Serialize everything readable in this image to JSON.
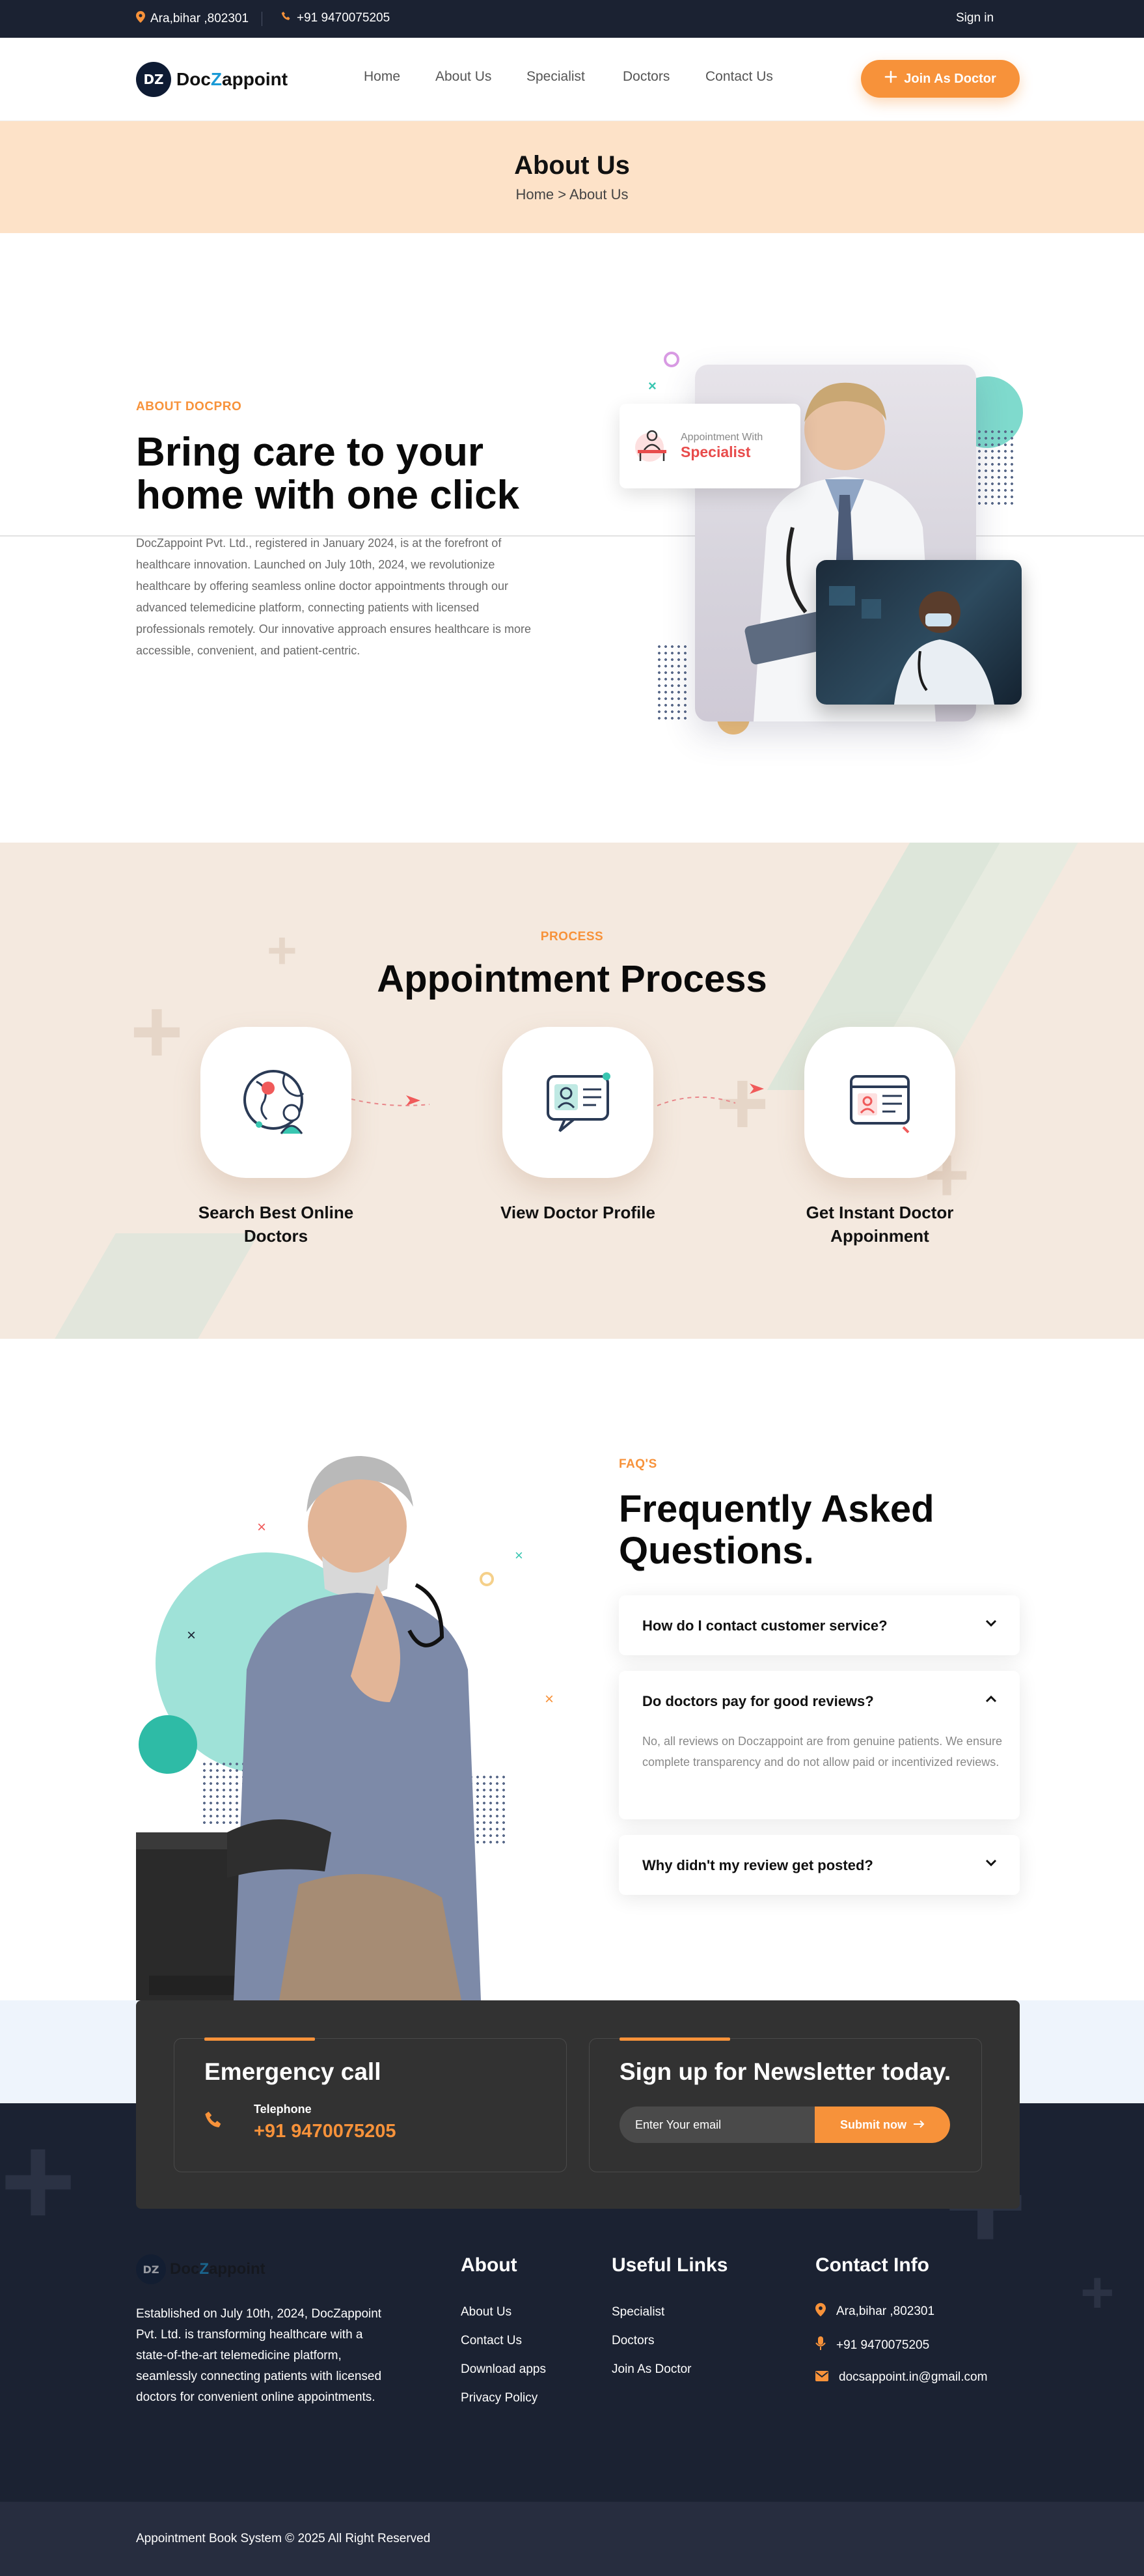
{
  "topbar": {
    "address": "Ara,bihar ,802301",
    "phone": "+91 9470075205",
    "signin": "Sign in"
  },
  "header": {
    "logo_mark": "DZ",
    "logo_prefix": "Doc",
    "logo_z": "Z",
    "logo_suffix": "appoint",
    "nav": [
      "Home",
      "About Us",
      "Specialist",
      "Doctors",
      "Contact Us"
    ],
    "cta": "Join As Doctor"
  },
  "banner": {
    "title": "About Us",
    "crumb_home": "Home",
    "crumb_sep": ">",
    "crumb_current": "About Us"
  },
  "about": {
    "eyebrow": "ABOUT DOCPRO",
    "heading_line1": "Bring care to your",
    "heading_line2": "home with one click",
    "paragraph": "DocZappoint Pvt. Ltd., registered in January 2024, is at the forefront of healthcare innovation. Launched on July 10th, 2024, we revolutionize healthcare by offering seamless online doctor appointments through our advanced telemedicine platform, connecting patients with licensed professionals remotely. Our innovative approach ensures healthcare is more accessible, convenient, and patient-centric.",
    "appointment_small": "Appointment With",
    "appointment_big": "Specialist"
  },
  "process": {
    "eyebrow": "PROCESS",
    "title": "Appointment Process",
    "steps": [
      {
        "label": "Search Best Online Doctors"
      },
      {
        "label": "View Doctor Profile"
      },
      {
        "label": "Get Instant Doctor Appoinment"
      }
    ]
  },
  "faq": {
    "eyebrow": "FAQ'S",
    "title_line1": "Frequently Asked",
    "title_line2": "Questions.",
    "items": [
      {
        "q": "How do I contact customer service?",
        "a": ""
      },
      {
        "q": "Do doctors pay for good reviews?",
        "a": "No, all reviews on Doczappoint are from genuine patients. We ensure complete transparency and do not allow paid or incentivized reviews."
      },
      {
        "q": "Why didn't my review get posted?",
        "a": ""
      }
    ]
  },
  "cta": {
    "emergency_title": "Emergency call",
    "telephone_label": "Telephone",
    "telephone_value": "+91 9470075205",
    "newsletter_title": "Sign up for Newsletter today.",
    "email_placeholder": "Enter Your email",
    "submit": "Submit now"
  },
  "footer": {
    "about_text": "Established on July 10th, 2024, DocZappoint Pvt. Ltd. is transforming healthcare with a state-of-the-art telemedicine platform, seamlessly connecting patients with licensed doctors for convenient online appointments.",
    "about_head": "About",
    "about_links": [
      "About Us",
      "Contact Us",
      "Download apps",
      "Privacy Policy"
    ],
    "useful_head": "Useful Links",
    "useful_links": [
      "Specialist",
      "Doctors",
      "Join As Doctor"
    ],
    "contact_head": "Contact Info",
    "contact_address": "Ara,bihar ,802301",
    "contact_phone": "+91 9470075205",
    "contact_email": "docsappoint.in@gmail.com",
    "copyright": "Appointment Book System © 2025 All Right Reserved"
  },
  "colors": {
    "accent": "#f7923a",
    "dark": "#1b2232",
    "banner": "#fde2c8",
    "process_bg": "#f4e9df",
    "teal": "#39c6b1"
  }
}
